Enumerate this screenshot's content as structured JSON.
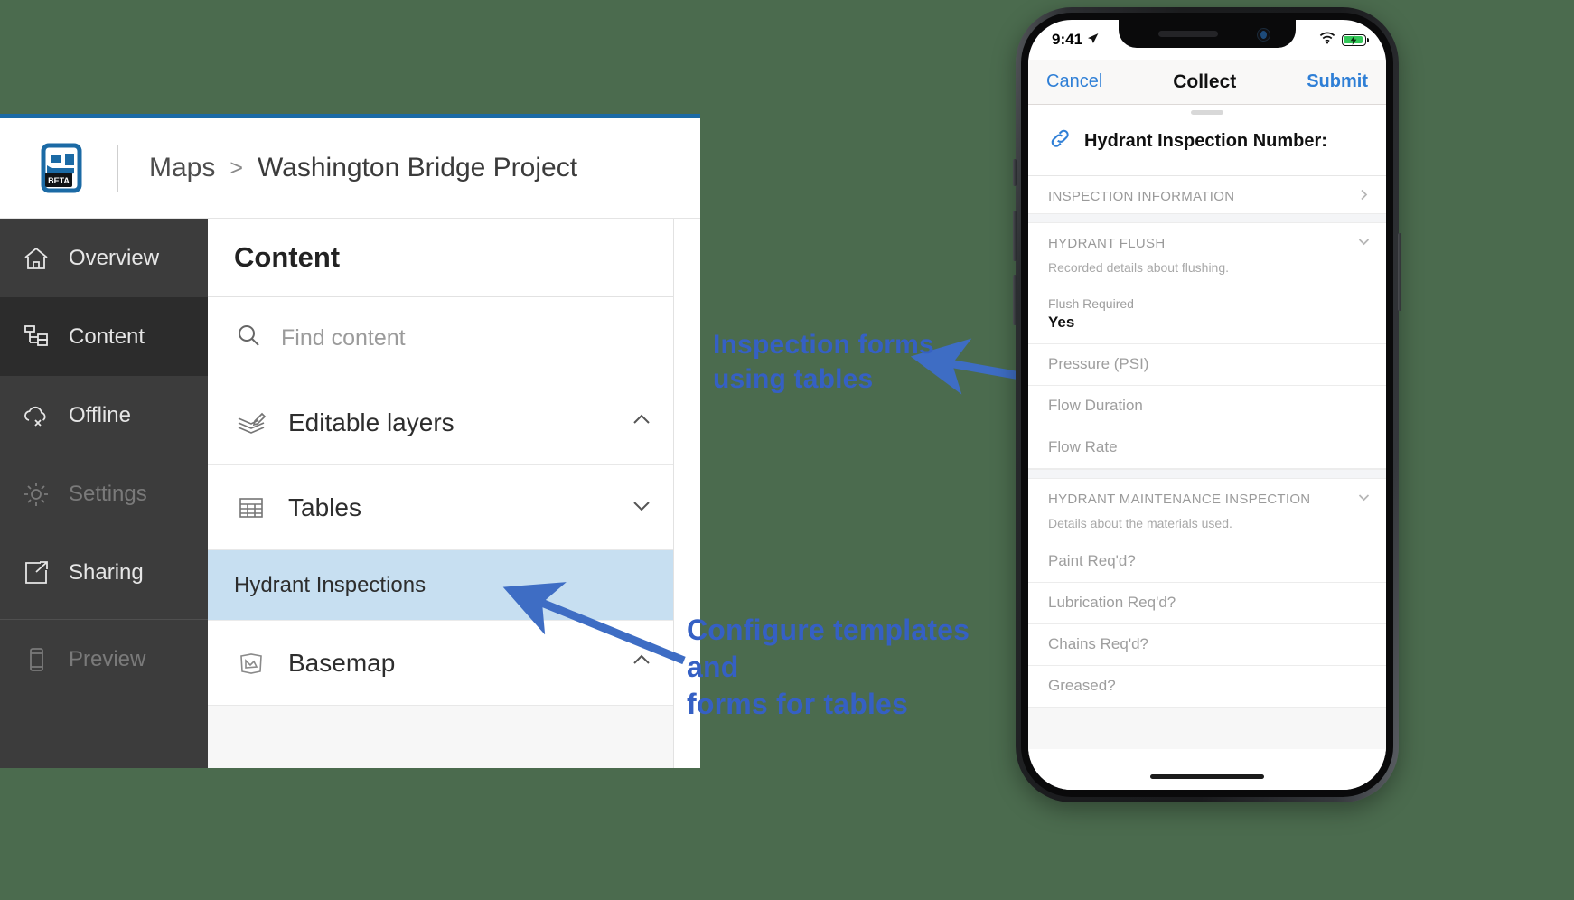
{
  "app": {
    "breadcrumb": {
      "root": "Maps",
      "separator": ">",
      "current": "Washington Bridge Project"
    },
    "logo_badge": "BETA",
    "logo_icon": "arcgis-map-logo-icon"
  },
  "sidebar": {
    "items": [
      {
        "label": "Overview",
        "icon": "home-icon",
        "state": "default"
      },
      {
        "label": "Content",
        "icon": "content-tree-icon",
        "state": "active"
      },
      {
        "label": "Offline",
        "icon": "cloud-offline-icon",
        "state": "default"
      },
      {
        "label": "Settings",
        "icon": "gear-icon",
        "state": "disabled"
      },
      {
        "label": "Sharing",
        "icon": "share-icon",
        "state": "default"
      },
      {
        "label": "Preview",
        "icon": "mobile-phone-icon",
        "state": "disabled"
      }
    ]
  },
  "content_panel": {
    "title": "Content",
    "search": {
      "placeholder": "Find content",
      "value": "",
      "icon": "search-icon"
    },
    "groups": [
      {
        "label": "Editable layers",
        "icon": "editable-layers-icon",
        "chevron": "chevron-up-icon"
      },
      {
        "label": "Tables",
        "icon": "table-icon",
        "chevron": "chevron-down-icon"
      }
    ],
    "selected_item": "Hydrant Inspections",
    "basemap": {
      "label": "Basemap",
      "icon": "basemap-icon",
      "chevron": "chevron-up-icon"
    }
  },
  "annotations": [
    {
      "text": "Inspection forms\nusing tables",
      "color": "#3560c4"
    },
    {
      "text": "Configure templates\nand\nforms for tables",
      "color": "#3560c4"
    }
  ],
  "phone": {
    "status_bar": {
      "time": "9:41",
      "location_icon": "location-arrow-icon",
      "wifi_icon": "wifi-icon",
      "battery_icon": "battery-charging-icon",
      "battery_color": "#34c759"
    },
    "nav_bar": {
      "cancel": "Cancel",
      "title": "Collect",
      "submit": "Submit",
      "accent": "#2f7fd6"
    },
    "form": {
      "header": {
        "icon": "link-icon",
        "title": "Hydrant Inspection Number:"
      },
      "sections": [
        {
          "name": "INSPECTION INFORMATION",
          "chevron": "chevron-right-icon",
          "description": "",
          "fields": []
        },
        {
          "name": "HYDRANT FLUSH",
          "chevron": "chevron-down-icon",
          "description": "Recorded details about flushing.",
          "fields": [
            {
              "label": "Flush Required",
              "value": "Yes"
            },
            {
              "label": "Pressure (PSI)",
              "value": ""
            },
            {
              "label": "Flow Duration",
              "value": ""
            },
            {
              "label": "Flow Rate",
              "value": ""
            }
          ]
        },
        {
          "name": "HYDRANT MAINTENANCE INSPECTION",
          "chevron": "chevron-down-icon",
          "description": "Details about the materials used.",
          "fields": [
            {
              "label": "Paint Req'd?",
              "value": ""
            },
            {
              "label": "Lubrication Req'd?",
              "value": ""
            },
            {
              "label": "Chains Req'd?",
              "value": ""
            },
            {
              "label": "Greased?",
              "value": ""
            }
          ]
        }
      ]
    }
  }
}
